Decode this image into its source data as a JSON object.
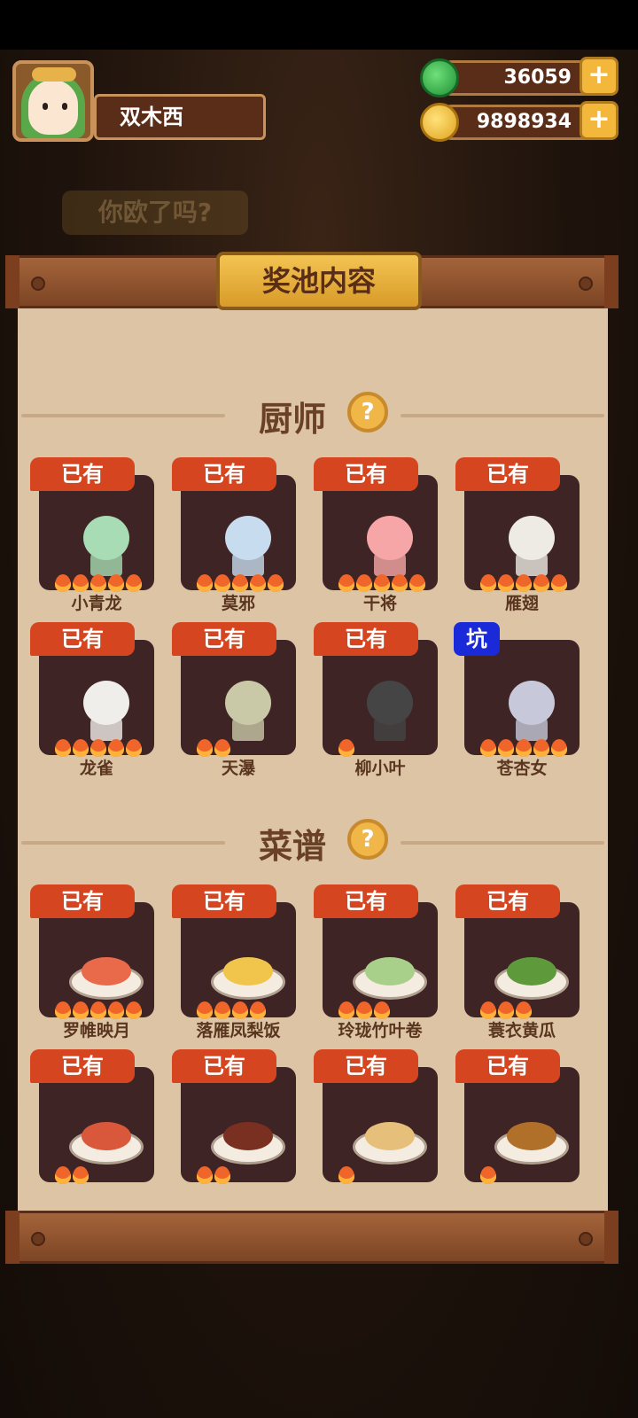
{
  "player": {
    "name": "双木西"
  },
  "currencies": {
    "jade": {
      "value": "36059",
      "icon": "jade-icon",
      "color": "#2fb24a"
    },
    "coin": {
      "value": "9898934",
      "icon": "coin-icon",
      "color": "#f2b62d"
    }
  },
  "background_banner": "你欧了吗?",
  "panel": {
    "title": "奖池内容"
  },
  "sections": {
    "chefs": {
      "title": "厨师",
      "help": "?"
    },
    "recipes": {
      "title": "菜谱",
      "help": "?"
    }
  },
  "chefs": [
    {
      "name": "小青龙",
      "tag": "已有",
      "stars": 5,
      "color": "#a8dcb4"
    },
    {
      "name": "莫邪",
      "tag": "已有",
      "stars": 5,
      "color": "#c8dcef"
    },
    {
      "name": "干将",
      "tag": "已有",
      "stars": 5,
      "color": "#f6a6a6"
    },
    {
      "name": "雁翅",
      "tag": "已有",
      "stars": 5,
      "color": "#eeeae4"
    },
    {
      "name": "龙雀",
      "tag": "已有",
      "stars": 5,
      "color": "#f0eeea"
    },
    {
      "name": "天瀑",
      "tag": "已有",
      "stars": 2,
      "color": "#c9c9a8"
    },
    {
      "name": "柳小叶",
      "tag": "已有",
      "stars": 1,
      "color": "#454545"
    },
    {
      "name": "苍杏女",
      "tag": "坑",
      "stars": 5,
      "color": "#c7c9db"
    }
  ],
  "recipes": [
    {
      "name": "罗帷映月",
      "tag": "已有",
      "stars": 5,
      "color": "#e86a4a"
    },
    {
      "name": "落雁凤梨饭",
      "tag": "已有",
      "stars": 4,
      "color": "#f1c44c"
    },
    {
      "name": "玲珑竹叶卷",
      "tag": "已有",
      "stars": 3,
      "color": "#a9d08a"
    },
    {
      "name": "蓑衣黄瓜",
      "tag": "已有",
      "stars": 3,
      "color": "#5e9a3c"
    },
    {
      "name": "",
      "tag": "已有",
      "stars": 2,
      "color": "#d9573a"
    },
    {
      "name": "",
      "tag": "已有",
      "stars": 2,
      "color": "#7a3020"
    },
    {
      "name": "",
      "tag": "已有",
      "stars": 1,
      "color": "#e6c07a"
    },
    {
      "name": "",
      "tag": "已有",
      "stars": 1,
      "color": "#b0702a"
    }
  ]
}
